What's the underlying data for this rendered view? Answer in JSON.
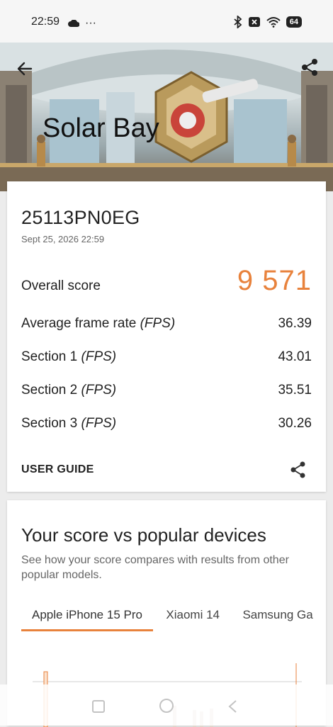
{
  "status": {
    "time": "22:59",
    "dots": "···",
    "battery": "64"
  },
  "hero": {
    "title": "Solar Bay"
  },
  "result": {
    "device": "25113PN0EG",
    "date": "Sept 25, 2026 22:59",
    "overall_label": "Overall score",
    "overall_value": "9 571",
    "rows": [
      {
        "label": "Average frame rate",
        "unit": "(FPS)",
        "value": "36.39"
      },
      {
        "label": "Section 1",
        "unit": "(FPS)",
        "value": "43.01"
      },
      {
        "label": "Section 2",
        "unit": "(FPS)",
        "value": "35.51"
      },
      {
        "label": "Section 3",
        "unit": "(FPS)",
        "value": "30.26"
      }
    ],
    "user_guide": "USER GUIDE"
  },
  "compare": {
    "title": "Your score vs popular devices",
    "description": "See how your score compares with results from other popular models.",
    "tabs": [
      "Apple iPhone 15 Pro",
      "Xiaomi 14",
      "Samsung Ga"
    ]
  },
  "colors": {
    "accent": "#e8823c"
  }
}
